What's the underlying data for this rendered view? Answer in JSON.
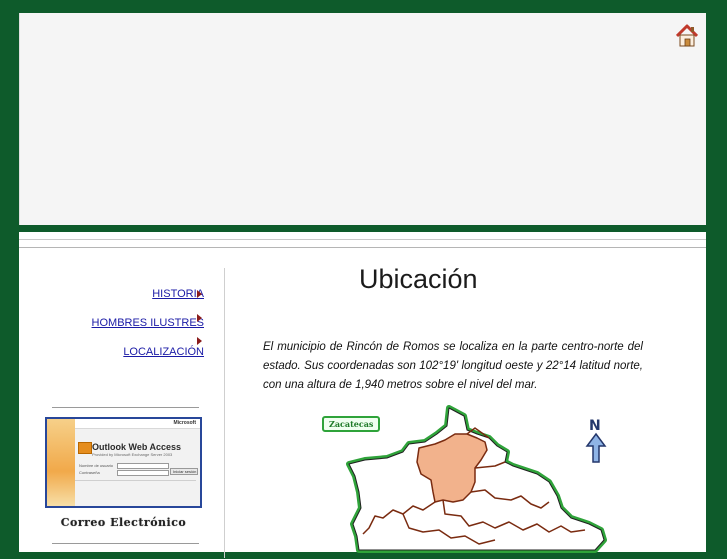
{
  "header": {
    "home_icon": "home-icon"
  },
  "sidebar": {
    "items": [
      {
        "label": "HISTORIA"
      },
      {
        "label": "HOMBRES ILUSTRES"
      },
      {
        "label": "LOCALIZACIÓN"
      }
    ],
    "owa": {
      "brand_small": "Microsoft",
      "title": "Outlook Web Access",
      "subtitle": "Provided by Microsoft Exchange Server 2003",
      "field_user": "Nombre de usuario",
      "field_pass": "Contraseña",
      "button": "Iniciar sesión",
      "caption": "Correo Electrónico"
    }
  },
  "main": {
    "title": "Ubicación",
    "intro": "El municipio de Rincón de Romos se localiza en la parte centro-norte del estado. Sus coordenadas son 102°19' longitud oeste y 22°14 latitud norte, con una altura de 1,940 metros sobre el nivel del mar.",
    "map": {
      "neighbor_label": "Zacatecas",
      "north_label": "N",
      "colors": {
        "highlight": "#f2b28c",
        "border": "#7a2b10",
        "outline": "#2fa33a"
      }
    }
  },
  "colors": {
    "background": "#0e5b2b",
    "nav_link": "#1a1aa6",
    "nav_arrow": "#8a1b1b"
  }
}
